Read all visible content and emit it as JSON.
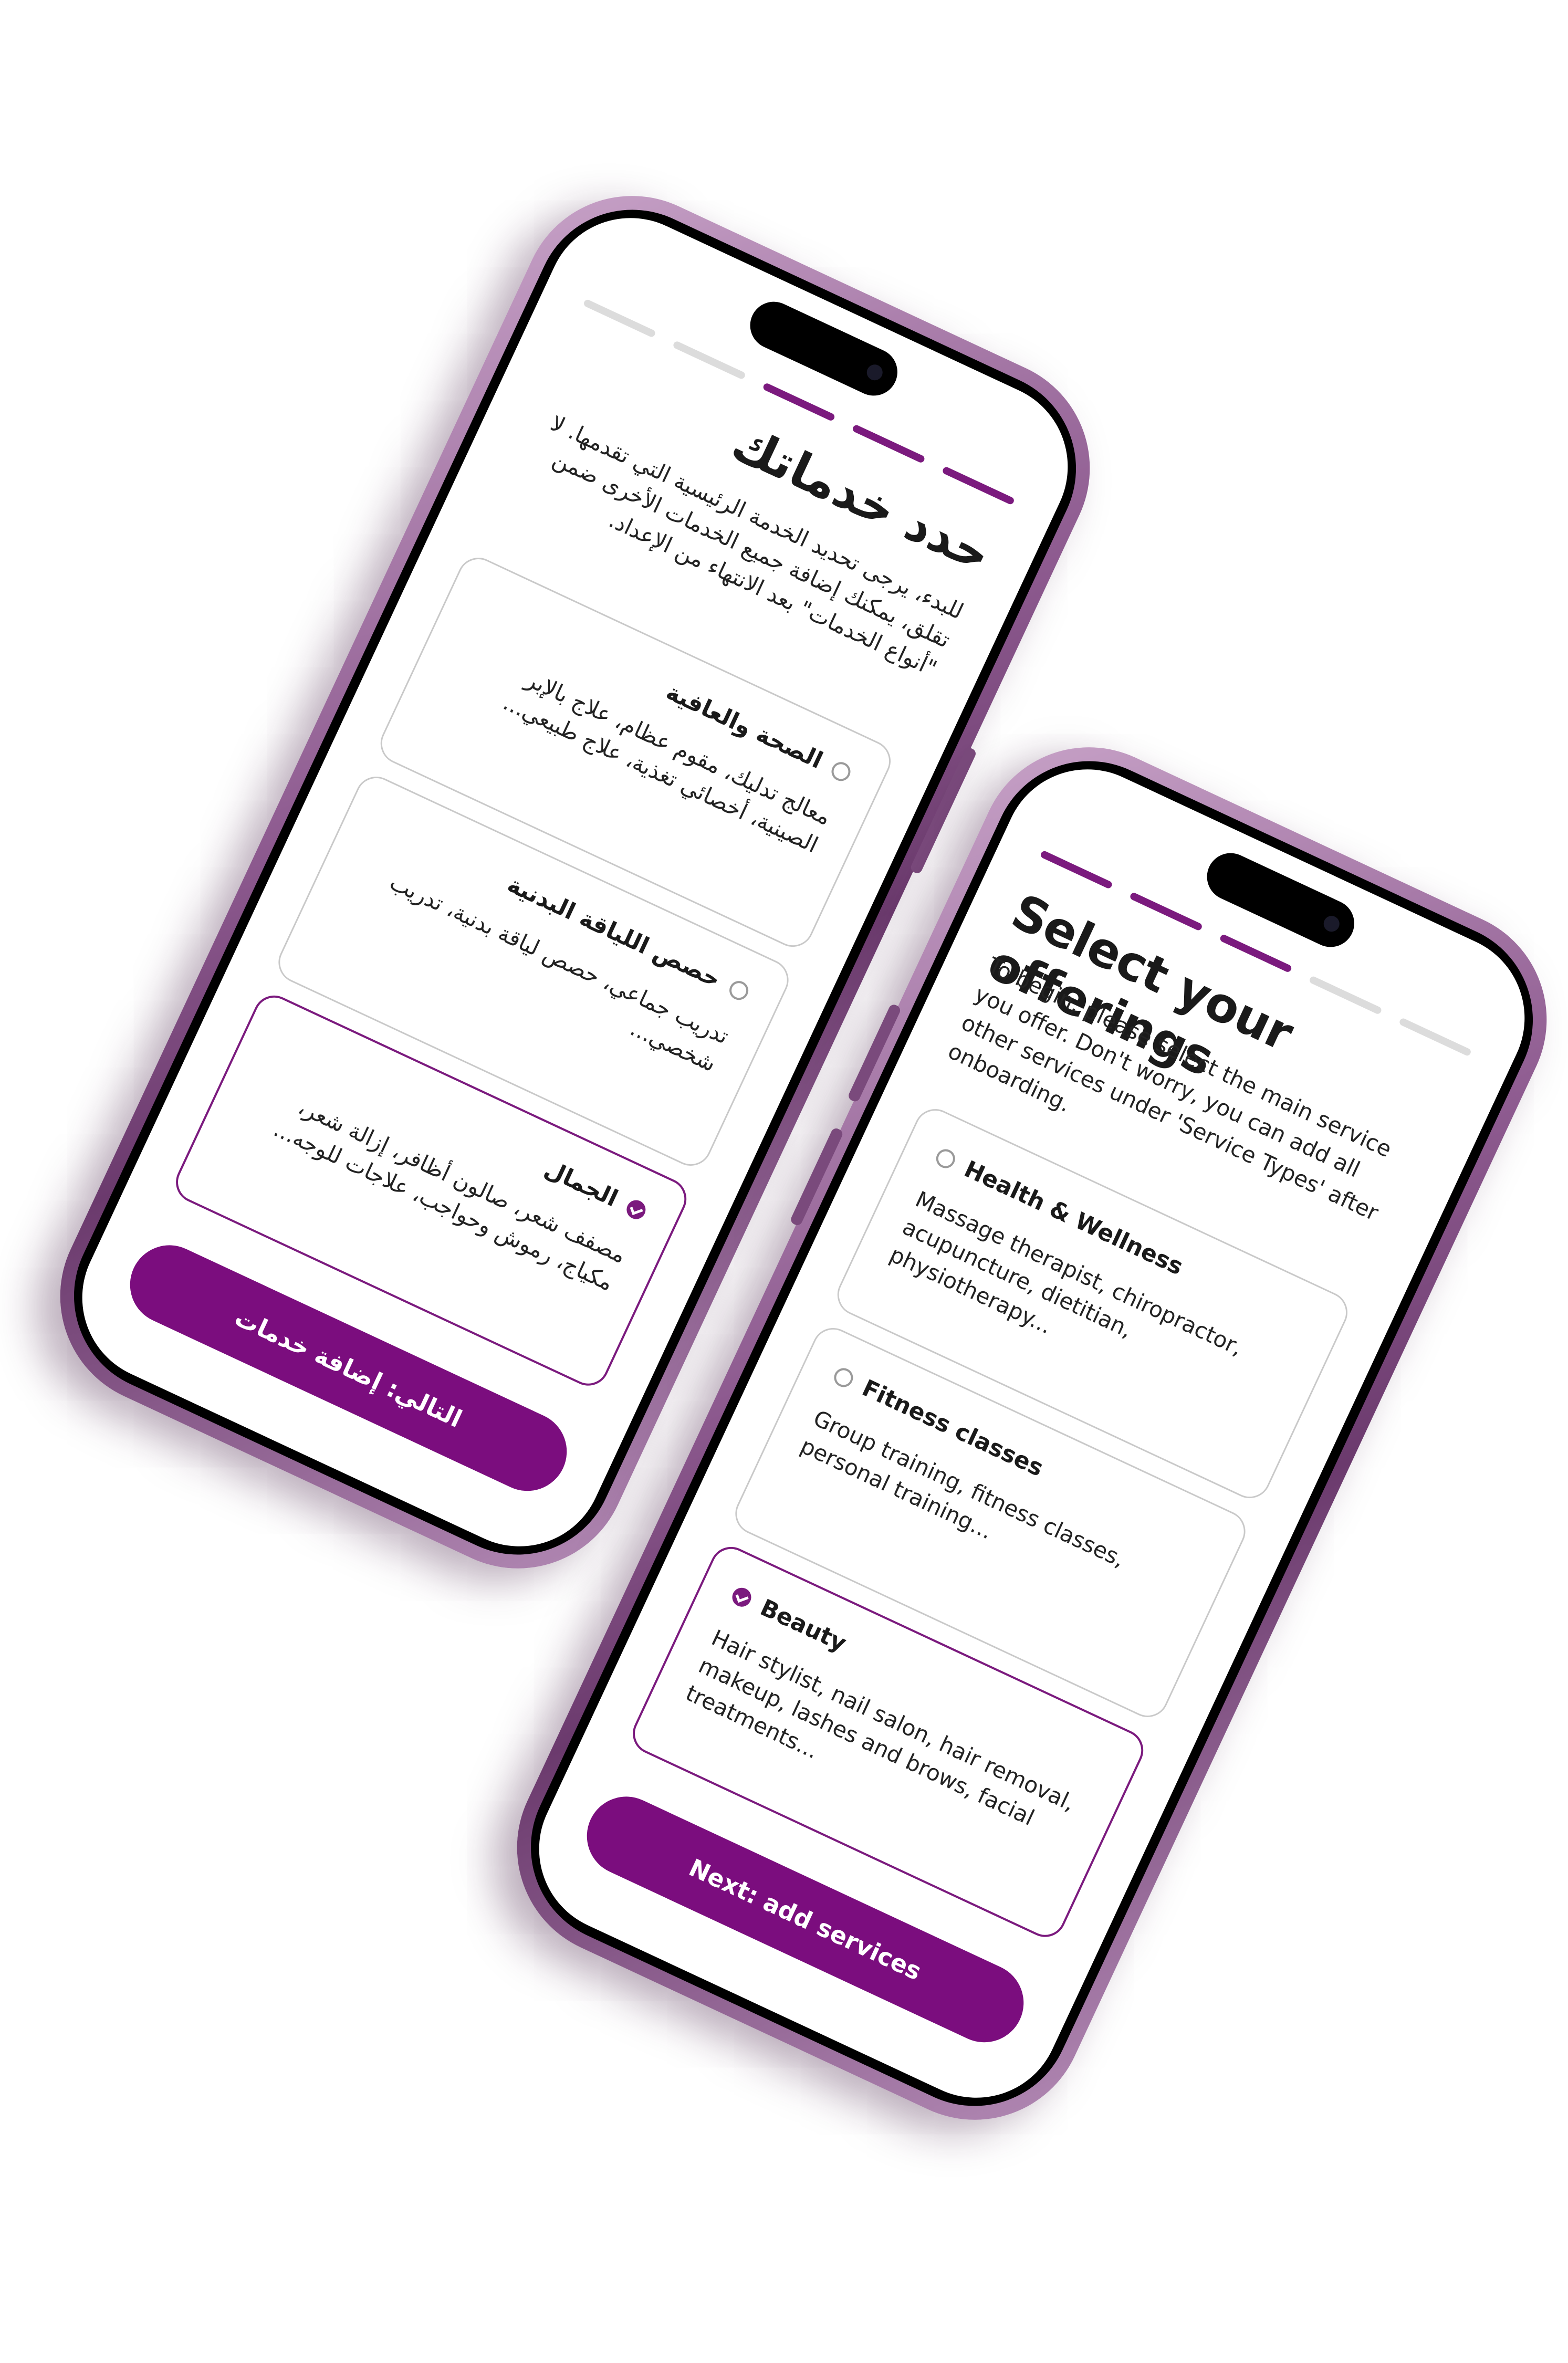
{
  "colors": {
    "brand_purple": "#7b0d7e",
    "progress_inactive": "#dcdcdc",
    "card_border": "#c9c9c9",
    "phone_frame": "#8d5a8f"
  },
  "arabic_screen": {
    "progress_active_steps": 3,
    "progress_total_steps": 5,
    "title": "حدد خدماتك",
    "subtitle": "للبدء، يرجى تحديد الخدمة الرئيسية التي تقدمها. لا تقلق، يمكنك إضافة جميع الخدمات الأخرى ضمن \"أنواع الخدمات\" بعد الانتهاء من الإعداد.",
    "options": [
      {
        "name": "الصحة والعافية",
        "description": "معالج تدليك، مقوم عظام، علاج بالإبر الصينية، أخصائي تغذية، علاج طبيعي...",
        "selected": false
      },
      {
        "name": "حصص اللياقة البدنية",
        "description": "تدريب جماعي، حصص لياقة بدنية، تدريب شخصي...",
        "selected": false
      },
      {
        "name": "الجمال",
        "description": "مصفف شعر، صالون أظافر، إزالة شعر، مكياج، رموش وحواجب، علاجات للوجه...",
        "selected": true
      }
    ],
    "next_label": "التالي: إضافة خدمات"
  },
  "english_screen": {
    "progress_active_steps": 3,
    "progress_total_steps": 5,
    "title": "Select your offerings",
    "subtitle": "To begin, please select the main service you offer. Don't worry, you can add all other services under 'Service Types' after onboarding.",
    "options": [
      {
        "name": "Health & Wellness",
        "description": "Massage therapist, chiropractor, acupuncture, dietitian, physiotherapy...",
        "selected": false
      },
      {
        "name": "Fitness classes",
        "description": "Group training, fitness classes, personal training...",
        "selected": false
      },
      {
        "name": "Beauty",
        "description": "Hair stylist, nail salon, hair removal, makeup, lashes and brows, facial treatments...",
        "selected": true
      }
    ],
    "next_label": "Next: add services"
  }
}
